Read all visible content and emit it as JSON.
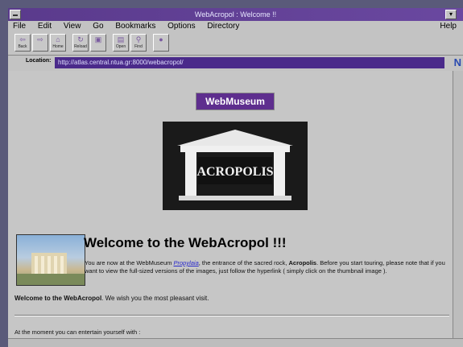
{
  "window": {
    "title": "WebAcropol : Welcome !!"
  },
  "menu": {
    "items": [
      "File",
      "Edit",
      "View",
      "Go",
      "Bookmarks",
      "Options",
      "Directory"
    ],
    "help": "Help"
  },
  "toolbar": {
    "buttons": [
      {
        "label": "Back",
        "icon": "back-arrow-icon"
      },
      {
        "label": "",
        "icon": "forward-arrow-icon"
      },
      {
        "label": "Home",
        "icon": "home-icon"
      },
      {
        "label": "Reload",
        "icon": "reload-icon"
      },
      {
        "label": "",
        "icon": "images-icon"
      },
      {
        "label": "Open",
        "icon": "open-icon"
      },
      {
        "label": "Find",
        "icon": "find-icon"
      },
      {
        "label": "",
        "icon": "stop-icon"
      }
    ]
  },
  "location": {
    "label": "Location:",
    "url": "http://atlas.central.ntua.gr:8000/webacropol/"
  },
  "page": {
    "banner": "WebMuseum",
    "acropolis_sign": "ACROPOLIS",
    "heading": "Welcome to the WebAcropol !!!",
    "para1_a": "You are now at the WebMuseum ",
    "para1_link": "Propylaia",
    "para1_b": ", the entrance of the sacred rock, ",
    "para1_bold": "Acropolis",
    "para1_c": ". Before you start touring, please note that if you want to view the full-sized versions of the images, just follow the hyperlink ( simply click on the thumbnail image ).",
    "para2_bold": "Welcome to the WebAcropol",
    "para2_rest": ". We wish you the most pleasant visit.",
    "para3": "At the moment you can entertain yourself with :"
  },
  "colors": {
    "titlebar": "#5a3a8c",
    "location_field": "#4a2a8a",
    "banner": "#5e2e8e"
  }
}
